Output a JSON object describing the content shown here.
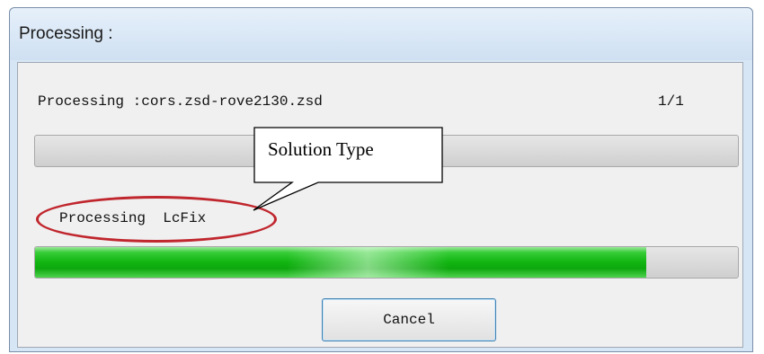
{
  "window": {
    "title": "Processing :"
  },
  "content": {
    "file_line": "Processing :cors.zsd-rove2130.zsd",
    "file_count": "1/1",
    "file_progress": 0,
    "step_line": "Processing  LcFix",
    "step_progress": 0.87
  },
  "buttons": {
    "cancel_label": "Cancel"
  },
  "annotation": {
    "callout_text": "Solution Type",
    "ellipse_color": "#c0262d"
  },
  "colors": {
    "progress_fill": "#10b410",
    "button_border": "#3c7fb1"
  }
}
